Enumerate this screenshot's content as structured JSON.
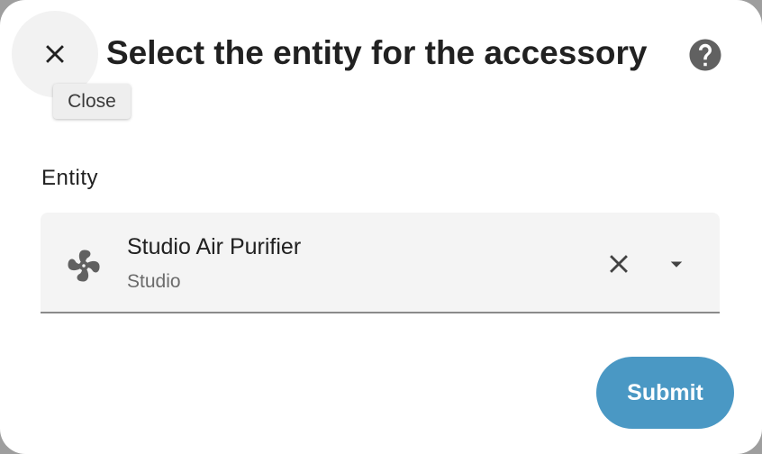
{
  "dialog": {
    "title": "Select the entity for the accessory",
    "close_tooltip": "Close",
    "close_icon": "close-icon",
    "help_icon": "help-circle-icon"
  },
  "form": {
    "label": "Entity",
    "picker": {
      "icon": "fan-icon",
      "entity_name": "Studio Air Purifier",
      "entity_area": "Studio",
      "clear_icon": "close-icon",
      "dropdown_icon": "menu-down-icon"
    }
  },
  "actions": {
    "submit_label": "Submit"
  },
  "colors": {
    "accent": "#4a98c4",
    "field_background": "#f4f4f4",
    "icon": "#616161"
  }
}
